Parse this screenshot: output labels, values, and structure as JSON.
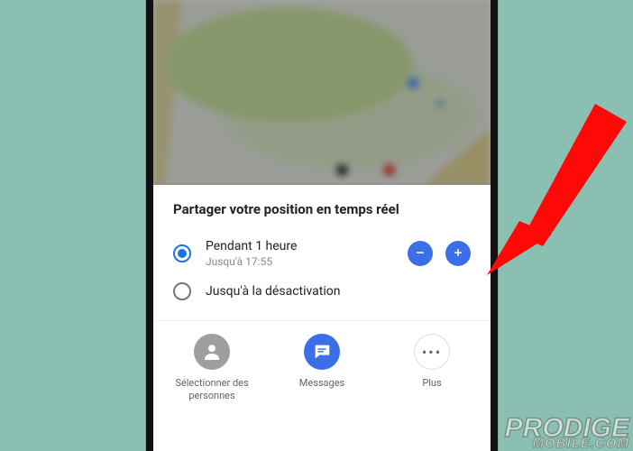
{
  "sheet": {
    "title": "Partager votre position en temps réel",
    "options": [
      {
        "primary": "Pendant 1 heure",
        "secondary": "Jusqu'à 17:55"
      },
      {
        "primary": "Jusqu'à la désactivation"
      }
    ]
  },
  "actions": {
    "select_people": "Sélectionner des personnes",
    "messages": "Messages",
    "more": "Plus"
  },
  "watermark": {
    "line1": "PRODIGE",
    "line2": "MOBILE.COM"
  },
  "colors": {
    "accent": "#3b6fe8"
  }
}
